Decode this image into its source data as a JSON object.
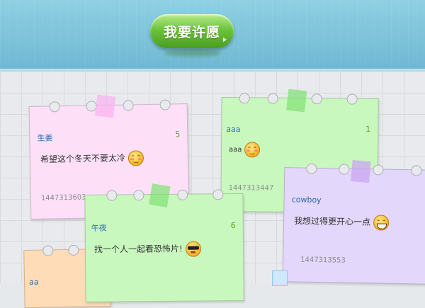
{
  "header": {
    "wish_button_label": "我要许愿"
  },
  "notes": [
    {
      "nickname": "生姜",
      "number": "5",
      "content": "希望这个冬天不要太冷",
      "timestamp": "1447313603",
      "color": "#fde0f8",
      "emoji": "blush-smile-icon"
    },
    {
      "nickname": "aaa",
      "number": "1",
      "content": "aaa",
      "timestamp": "1447313447",
      "color": "#c9f8bf",
      "emoji": "blush-smile-icon"
    },
    {
      "nickname": "cowboy",
      "number": "",
      "content": "我想过得更开心一点",
      "timestamp": "1447313553",
      "color": "#e3d7fb",
      "emoji": "grin-icon"
    },
    {
      "nickname": "午夜",
      "number": "6",
      "content": "找一个人一起看恐怖片!",
      "timestamp": "",
      "color": "#c9f8bf",
      "emoji": "sunglasses-icon"
    },
    {
      "nickname": "aa",
      "color": "#fedcb8"
    }
  ]
}
